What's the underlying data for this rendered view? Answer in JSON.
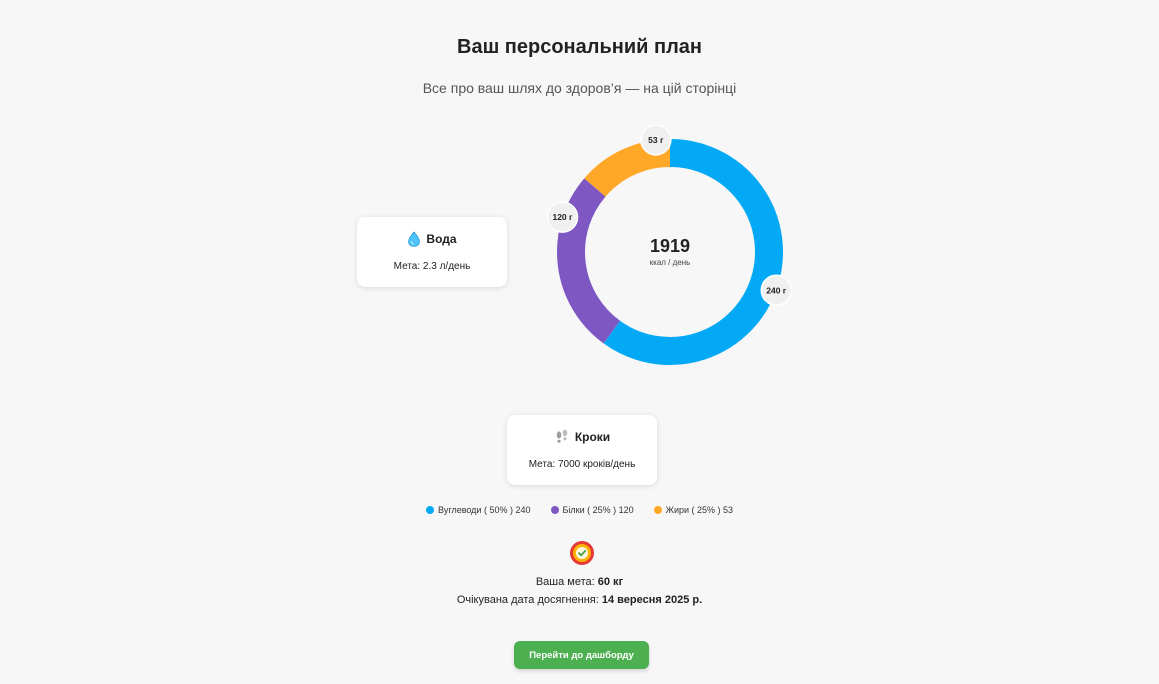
{
  "header": {
    "title": "Ваш персональний план",
    "subtitle": "Все про ваш шлях до здоров’я — на цій сторінці"
  },
  "water_card": {
    "icon": "water-drop-icon",
    "title": "Вода",
    "meta": "Мета: 2.3 л/день"
  },
  "steps_card": {
    "icon": "footprints-icon",
    "title": "Кроки",
    "meta": "Мета: 7000 кроків/день"
  },
  "donut": {
    "center_value": "1919",
    "center_unit": "ккал / день",
    "labels": [
      "240 г",
      "120 г",
      "53 г"
    ]
  },
  "chart_data": {
    "type": "pie",
    "categories": [
      "Вуглеводи",
      "Білки",
      "Жири"
    ],
    "values": [
      240,
      120,
      53
    ],
    "arc_fractions": [
      0.6,
      0.263,
      0.137
    ],
    "colors": [
      "#03a9f4",
      "#7e57c2",
      "#ffa726"
    ],
    "center_value": 1919,
    "center_unit": "ккал / день"
  },
  "legend": [
    {
      "name": "Вуглеводи",
      "text": "Вуглеводи ( 50% ) 240",
      "color": "#03a9f4"
    },
    {
      "name": "Білки",
      "text": "Білки ( 25% ) 120",
      "color": "#7e57c2"
    },
    {
      "name": "Жири",
      "text": "Жири ( 25% ) 53",
      "color": "#ffa726"
    }
  ],
  "goal": {
    "icon": "target-check-icon",
    "weight_label": "Ваша мета:",
    "weight_value": "60 кг",
    "date_label": "Очікувана дата досягнення:",
    "date_value": "14 вересня 2025 р."
  },
  "cta": {
    "label": "Перейти до дашборду"
  }
}
